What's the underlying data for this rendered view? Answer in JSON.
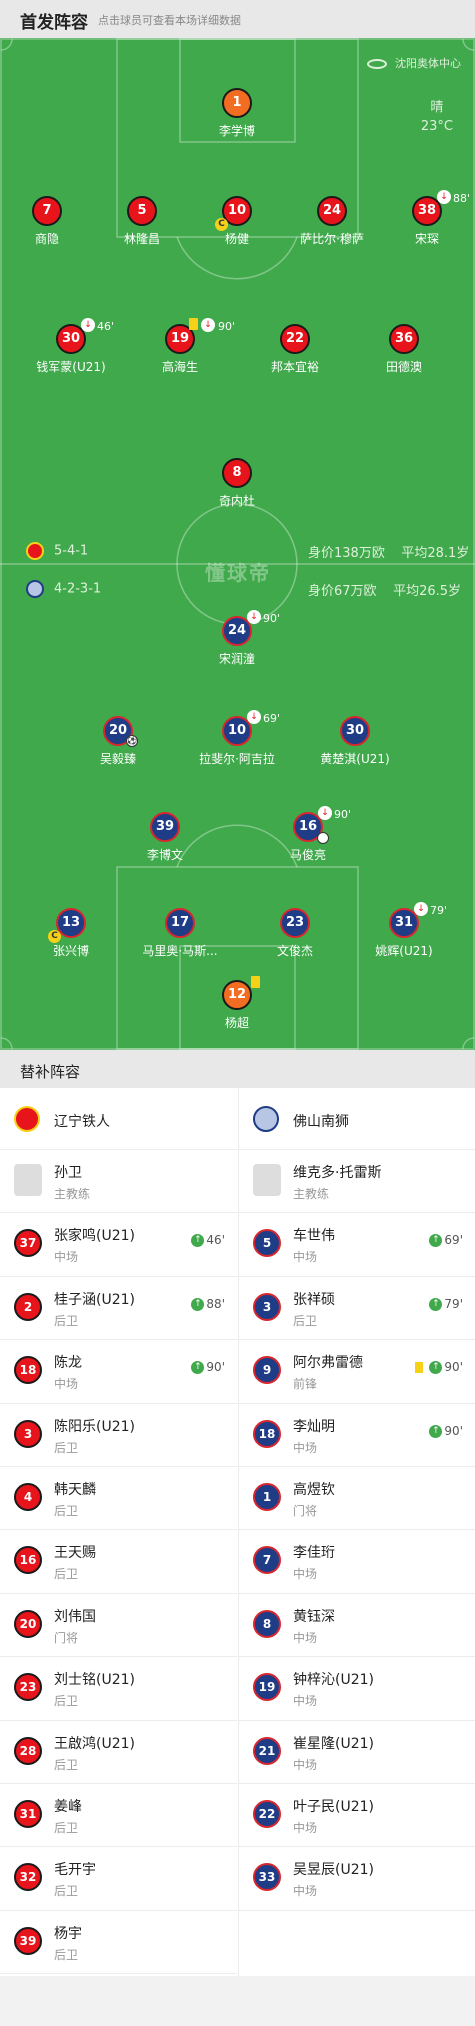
{
  "header": {
    "title": "首发阵容",
    "subtitle": "点击球员可查看本场详细数据"
  },
  "pitch": {
    "venue": "沈阳奥体中心",
    "weather": {
      "condition": "晴",
      "temp": "23°C"
    },
    "watermark": "懂球帝",
    "home_team": {
      "formation": "5-4-1",
      "value": "身价138万欧",
      "avg_age": "平均28.1岁"
    },
    "away_team": {
      "formation": "4-2-3-1",
      "value": "身价67万欧",
      "avg_age": "平均26.5岁"
    },
    "home_players": [
      {
        "number": "1",
        "name": "李学博",
        "role": "gk"
      },
      {
        "number": "7",
        "name": "商隐"
      },
      {
        "number": "5",
        "name": "林隆昌"
      },
      {
        "number": "10",
        "name": "杨健",
        "captain": true
      },
      {
        "number": "24",
        "name": "萨比尔·穆萨"
      },
      {
        "number": "38",
        "name": "宋琛",
        "sub_minute": "88'"
      },
      {
        "number": "30",
        "name": "钱军蒙(U21)",
        "sub_minute": "46'"
      },
      {
        "number": "19",
        "name": "高海生",
        "sub_minute": "90'",
        "yellow": true
      },
      {
        "number": "22",
        "name": "邦本宜裕"
      },
      {
        "number": "36",
        "name": "田德澳"
      },
      {
        "number": "8",
        "name": "奇内杜"
      }
    ],
    "away_players": [
      {
        "number": "24",
        "name": "宋润潼",
        "sub_minute": "90'"
      },
      {
        "number": "20",
        "name": "吴毅臻",
        "goal": true
      },
      {
        "number": "10",
        "name": "拉斐尔·阿吉拉",
        "sub_minute": "69'"
      },
      {
        "number": "30",
        "name": "黄楚淇(U21)"
      },
      {
        "number": "39",
        "name": "李博文"
      },
      {
        "number": "16",
        "name": "马俊亮",
        "sub_minute": "90'",
        "assist": true
      },
      {
        "number": "13",
        "name": "张兴博",
        "captain": true
      },
      {
        "number": "17",
        "name": "马里奥·马斯..."
      },
      {
        "number": "23",
        "name": "文俊杰"
      },
      {
        "number": "31",
        "name": "姚辉(U21)",
        "sub_minute": "79'"
      },
      {
        "number": "12",
        "name": "杨超",
        "role": "gk",
        "yellow": true
      }
    ]
  },
  "subs": {
    "title": "替补阵容",
    "home": {
      "team_name": "辽宁铁人",
      "coach": {
        "name": "孙卫",
        "role": "主教练"
      },
      "players": [
        {
          "number": "37",
          "name": "张家鸣(U21)",
          "position": "中场",
          "in": "46'"
        },
        {
          "number": "2",
          "name": "桂子涵(U21)",
          "position": "后卫",
          "in": "88'"
        },
        {
          "number": "18",
          "name": "陈龙",
          "position": "中场",
          "in": "90'"
        },
        {
          "number": "3",
          "name": "陈阳乐(U21)",
          "position": "后卫"
        },
        {
          "number": "4",
          "name": "韩天麟",
          "position": "后卫"
        },
        {
          "number": "16",
          "name": "王天赐",
          "position": "后卫"
        },
        {
          "number": "20",
          "name": "刘伟国",
          "position": "门将"
        },
        {
          "number": "23",
          "name": "刘士铭(U21)",
          "position": "后卫"
        },
        {
          "number": "28",
          "name": "王啟鸿(U21)",
          "position": "后卫"
        },
        {
          "number": "31",
          "name": "姜峰",
          "position": "后卫"
        },
        {
          "number": "32",
          "name": "毛开宇",
          "position": "后卫"
        },
        {
          "number": "39",
          "name": "杨宇",
          "position": "后卫"
        }
      ]
    },
    "away": {
      "team_name": "佛山南狮",
      "coach": {
        "name": "维克多·托雷斯",
        "role": "主教练"
      },
      "players": [
        {
          "number": "5",
          "name": "车世伟",
          "position": "中场",
          "in": "69'"
        },
        {
          "number": "3",
          "name": "张祥硕",
          "position": "后卫",
          "in": "79'"
        },
        {
          "number": "9",
          "name": "阿尔弗雷德",
          "position": "前锋",
          "in": "90'",
          "yellow": true
        },
        {
          "number": "18",
          "name": "李灿明",
          "position": "中场",
          "in": "90'"
        },
        {
          "number": "1",
          "name": "高煜钦",
          "position": "门将"
        },
        {
          "number": "7",
          "name": "李佳珩",
          "position": "中场"
        },
        {
          "number": "8",
          "name": "黄钰深",
          "position": "中场"
        },
        {
          "number": "19",
          "name": "钟梓沁(U21)",
          "position": "中场"
        },
        {
          "number": "21",
          "name": "崔星隆(U21)",
          "position": "中场"
        },
        {
          "number": "22",
          "name": "叶子民(U21)",
          "position": "中场"
        },
        {
          "number": "33",
          "name": "吴昱辰(U21)",
          "position": "中场"
        }
      ]
    }
  },
  "colors": {
    "pitch": "#3fa94b",
    "home": "#e8141b",
    "away": "#1f3c86",
    "gk": "#f26c22",
    "yellow_card": "#f7d117"
  }
}
